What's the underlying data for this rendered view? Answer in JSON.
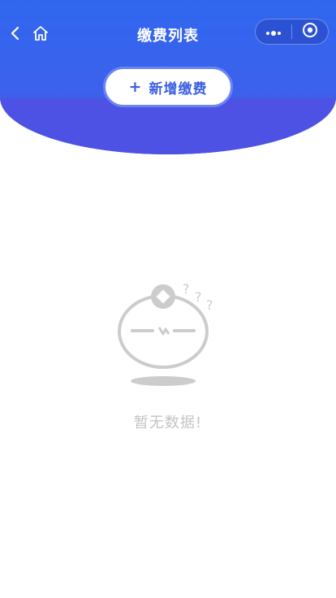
{
  "navbar": {
    "title": "缴费列表",
    "back_icon": "chevron-left-icon",
    "home_icon": "home-icon",
    "capsule": {
      "more_icon": "more-dots-icon",
      "close_icon": "target-circle-icon"
    }
  },
  "actions": {
    "add_plus": "+",
    "add_label": "新增缴费"
  },
  "empty_state": {
    "icon": "empty-face-icon",
    "question_marks": [
      "?",
      "?",
      "?"
    ],
    "message": "暂无数据!"
  },
  "colors": {
    "primary": "#3066ef",
    "band": "#4d52e4",
    "button_text": "#3a5fe4",
    "empty_gray": "#c4c4c4"
  }
}
